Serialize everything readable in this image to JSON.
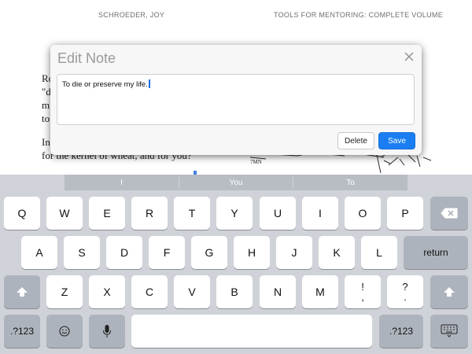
{
  "page": {
    "running_head_left": "SCHROEDER, JOY",
    "running_head_right": "TOOLS FOR MENTORING: COMPLETE VOLUME",
    "body_lines": [
      "Ro",
      "\"d",
      "m",
      "to",
      "In",
      "for the kernel of wheat, and for you?"
    ]
  },
  "dialog": {
    "title": "Edit Note",
    "note_text": "To die or preserve my life.",
    "delete_label": "Delete",
    "save_label": "Save",
    "accent_color": "#1a7ef2"
  },
  "suggestions": [
    "I",
    "You",
    "To"
  ],
  "keyboard": {
    "row1": [
      "Q",
      "W",
      "E",
      "R",
      "T",
      "Y",
      "U",
      "I",
      "O",
      "P"
    ],
    "row2": [
      "A",
      "S",
      "D",
      "F",
      "G",
      "H",
      "J",
      "K",
      "L"
    ],
    "row3": [
      "Z",
      "X",
      "C",
      "V",
      "B",
      "N",
      "M"
    ],
    "return_label": "return",
    "punct1_top": "!",
    "punct1_bottom": ",",
    "punct2_top": "?",
    "punct2_bottom": ".",
    "numbers_label": ".?123",
    "icons": [
      "backspace-icon",
      "shift-icon",
      "emoji-icon",
      "microphone-icon",
      "hide-keyboard-icon"
    ]
  }
}
